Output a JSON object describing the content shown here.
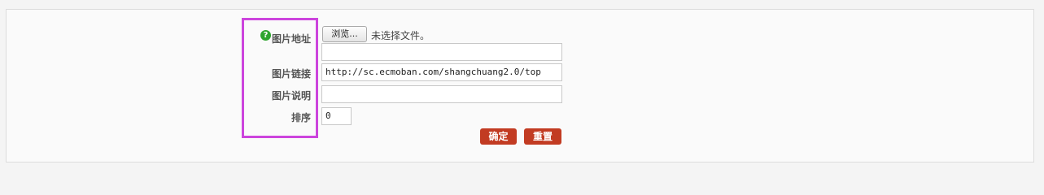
{
  "form": {
    "image_address": {
      "label": "图片地址",
      "browse_button": "浏览...",
      "no_file_text": "未选择文件。",
      "url_value": ""
    },
    "image_link": {
      "label": "图片链接",
      "value": "http://sc.ecmoban.com/shangchuang2.0/top"
    },
    "image_description": {
      "label": "图片说明",
      "value": ""
    },
    "sort_order": {
      "label": "排序",
      "value": "0"
    },
    "confirm_button": "确定",
    "reset_button": "重置"
  },
  "help_icon": {
    "name": "help-icon",
    "glyph": "?"
  },
  "colors": {
    "accent_button": "#c23b22",
    "highlight_box": "#cc44dd",
    "help_icon": "#2ea52e"
  }
}
